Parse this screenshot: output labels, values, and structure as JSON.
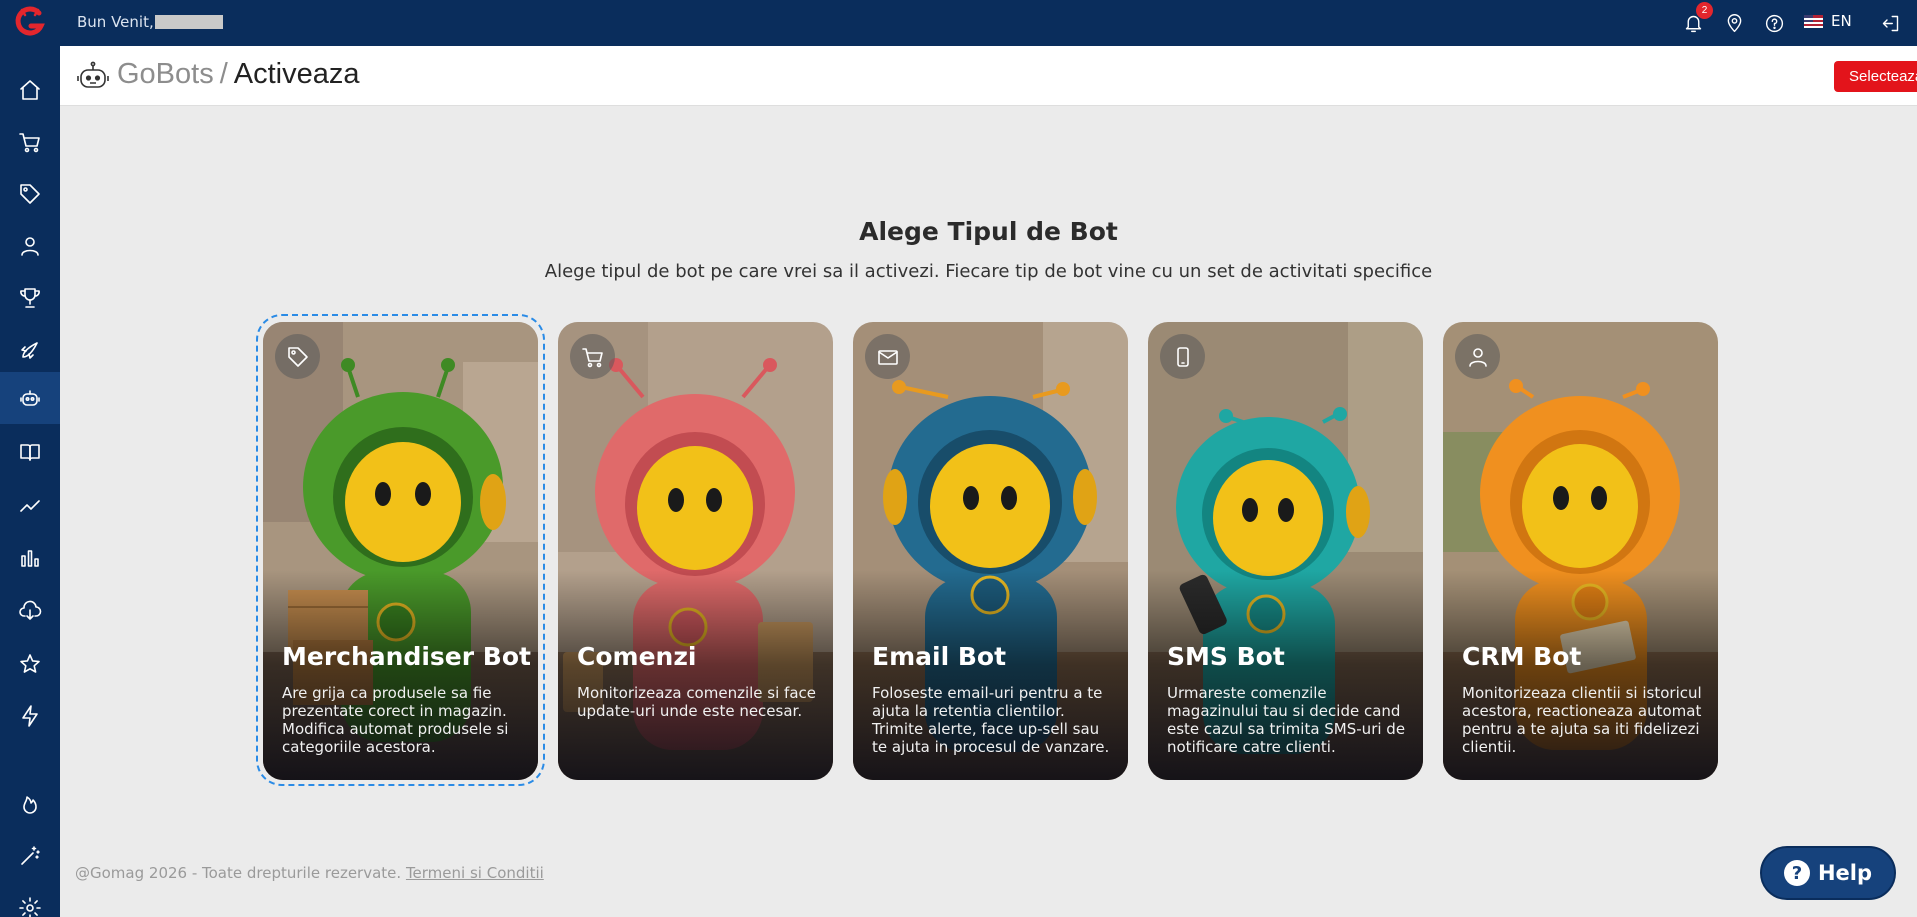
{
  "topbar": {
    "greeting": "Bun Venit,",
    "notifications_count": "2",
    "language": "EN",
    "icons": [
      "bell-icon",
      "location-pin-icon",
      "help-circle-icon",
      "uk-flag-icon",
      "logout-icon"
    ]
  },
  "sidebar": {
    "logo": "gomag-logo",
    "items": [
      {
        "icon": "home-icon"
      },
      {
        "icon": "cart-icon"
      },
      {
        "icon": "tag-icon"
      },
      {
        "icon": "customers-icon"
      },
      {
        "icon": "trophy-icon"
      },
      {
        "icon": "rocket-icon"
      },
      {
        "icon": "robot-icon",
        "active": true
      },
      {
        "icon": "book-icon"
      },
      {
        "icon": "trend-icon"
      },
      {
        "icon": "bar-chart-icon"
      },
      {
        "icon": "cloud-download-icon"
      },
      {
        "icon": "star-icon"
      },
      {
        "icon": "lightning-icon"
      },
      {
        "icon": "flame-icon"
      },
      {
        "icon": "magic-wand-icon"
      },
      {
        "icon": "settings-icon"
      }
    ]
  },
  "header": {
    "breadcrumb_parent": "GoBots",
    "breadcrumb_separator": "/",
    "breadcrumb_current": "Activeaza",
    "select_button": "Selecteaza Bot"
  },
  "main": {
    "title": "Alege Tipul de Bot",
    "subtitle": "Alege tipul de bot pe care vrei sa il activezi. Fiecare tip de bot vine cu un set de activitati specifice",
    "cards": [
      {
        "title": "Merchandiser Bot",
        "description": "Are grija ca produsele sa fie prezentate corect in magazin. Modifica automat produsele si categoriile acestora.",
        "icon": "tag-icon",
        "color": "#4a9a2a",
        "selected": true
      },
      {
        "title": "Comenzi",
        "description": "Monitorizeaza comenzile si face update-uri unde este necesar.",
        "icon": "cart-icon",
        "color": "#e06a6a",
        "selected": false
      },
      {
        "title": "Email Bot",
        "description": "Foloseste email-uri pentru a te ajuta la retentia clientilor. Trimite alerte, face up-sell sau te ajuta in procesul de vanzare.",
        "icon": "envelope-icon",
        "color": "#236b90",
        "selected": false
      },
      {
        "title": "SMS Bot",
        "description": "Urmareste comenzile magazinului tau si decide cand este cazul sa trimita SMS-uri de notificare catre clienti.",
        "icon": "phone-icon",
        "color": "#1fa7a3",
        "selected": false
      },
      {
        "title": "CRM Bot",
        "description": "Monitorizeaza clientii si istoricul acestora, reactioneaza automat pentru a te ajuta sa iti fidelizezi clientii.",
        "icon": "user-icon",
        "color": "#f0901f",
        "selected": false
      }
    ]
  },
  "footer": {
    "copyright": "@Gomag 2026 - Toate drepturile rezervate.",
    "terms_link": "Termeni si Conditii"
  },
  "help_button": "Help"
}
